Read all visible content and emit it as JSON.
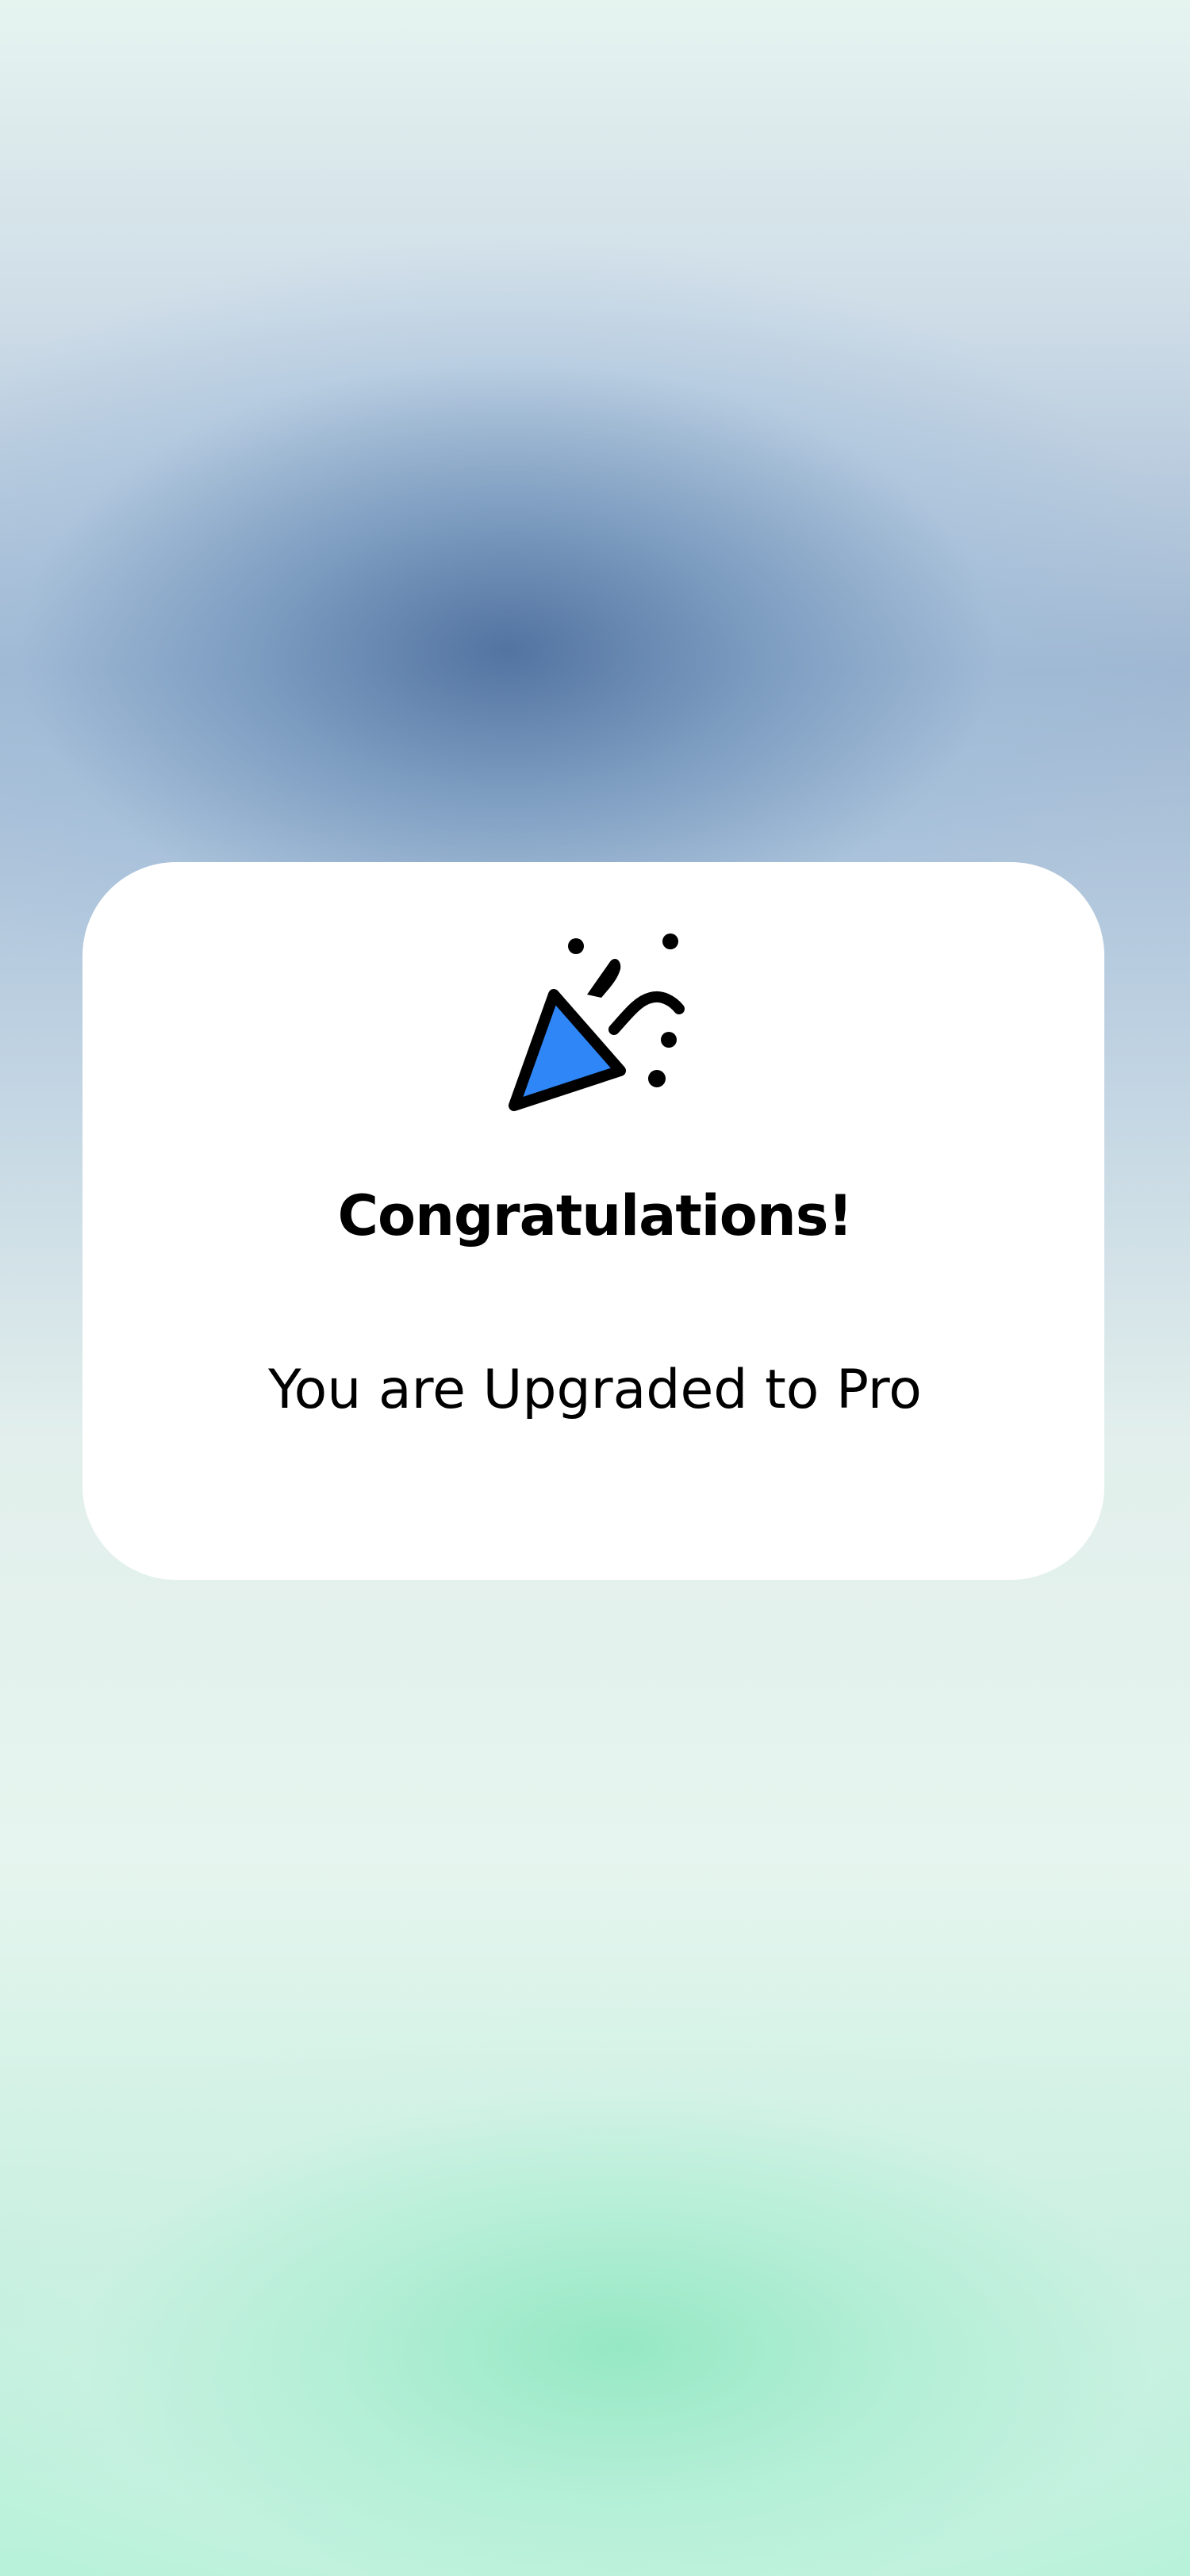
{
  "background": {
    "top_color": "#6f8fb6",
    "bottom_color": "#a8edcf"
  },
  "dialog": {
    "icon": "party-popper-icon",
    "icon_color": "#2f86f6",
    "title": "Congratulations!",
    "message": "You are Upgraded to Pro"
  }
}
